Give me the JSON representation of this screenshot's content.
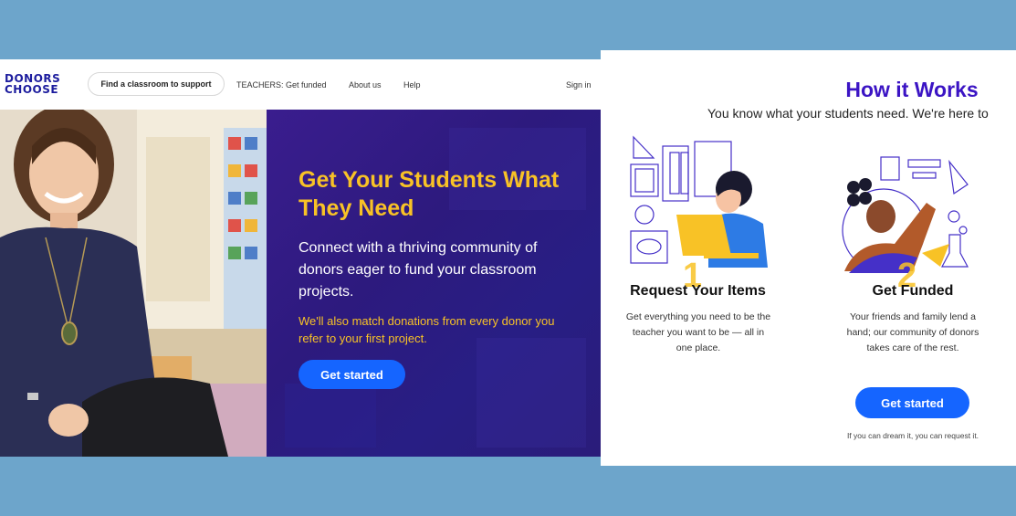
{
  "logo": {
    "line1": "DONORS",
    "line2": "CHOOSE"
  },
  "nav": {
    "find_classroom": "Find a classroom to support",
    "teachers": "TEACHERS: Get funded",
    "about": "About us",
    "help": "Help",
    "sign_in": "Sign in"
  },
  "hero": {
    "title": "Get Your Students What They Need",
    "subtitle": "Connect with a thriving community of donors eager to fund your classroom projects.",
    "match": "We'll also match donations from every donor you refer to your first project.",
    "cta": "Get started"
  },
  "how": {
    "title": "How it Works",
    "subtitle": "You know what your students need. We're here to",
    "steps": [
      {
        "number": "1",
        "title": "Request Your Items",
        "desc": "Get everything you need to be the teacher you want to be — all in one place."
      },
      {
        "number": "2",
        "title": "Get Funded",
        "desc": "Your friends and family lend a hand; our community of donors takes care of the rest."
      }
    ],
    "cta": "Get started",
    "tagline": "If you can dream it, you can request it."
  },
  "colors": {
    "background": "#6da5cb",
    "accent_yellow": "#f8c226",
    "brand_purple": "#3b14c4",
    "cta_blue": "#1565ff"
  }
}
